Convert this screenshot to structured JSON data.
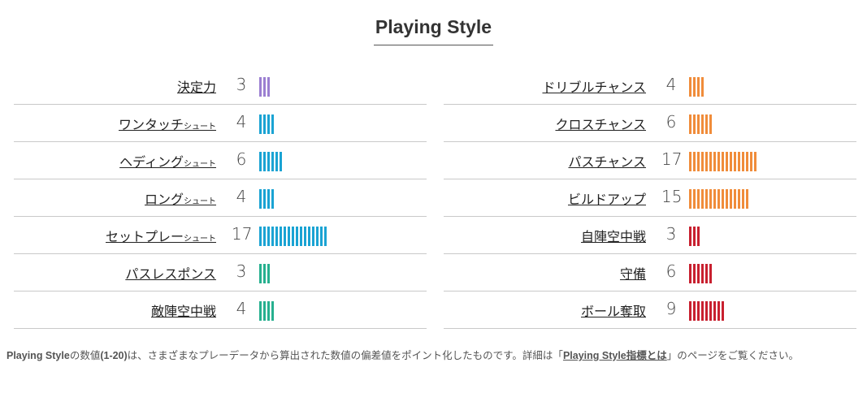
{
  "title": "Playing Style",
  "colors": {
    "purple": "#9b7fd1",
    "blue": "#1aa3d3",
    "teal": "#27b08f",
    "orange": "#f08c3a",
    "red": "#c8202f"
  },
  "left": [
    {
      "label": "決定力",
      "sub": "",
      "value": 3,
      "color": "#9b7fd1"
    },
    {
      "label": "ワンタッチ",
      "sub": "シュート",
      "value": 4,
      "color": "#1aa3d3"
    },
    {
      "label": "ヘディング",
      "sub": "シュート",
      "value": 6,
      "color": "#1aa3d3"
    },
    {
      "label": "ロング",
      "sub": "シュート",
      "value": 4,
      "color": "#1aa3d3"
    },
    {
      "label": "セットプレー",
      "sub": "シュート",
      "value": 17,
      "color": "#1aa3d3"
    },
    {
      "label": "パスレスポンス",
      "sub": "",
      "value": 3,
      "color": "#27b08f"
    },
    {
      "label": "敵陣空中戦",
      "sub": "",
      "value": 4,
      "color": "#27b08f"
    }
  ],
  "right": [
    {
      "label": "ドリブルチャンス",
      "sub": "",
      "value": 4,
      "color": "#f08c3a"
    },
    {
      "label": "クロスチャンス",
      "sub": "",
      "value": 6,
      "color": "#f08c3a"
    },
    {
      "label": "パスチャンス",
      "sub": "",
      "value": 17,
      "color": "#f08c3a"
    },
    {
      "label": "ビルドアップ",
      "sub": "",
      "value": 15,
      "color": "#f08c3a"
    },
    {
      "label": "自陣空中戦",
      "sub": "",
      "value": 3,
      "color": "#c8202f"
    },
    {
      "label": "守備",
      "sub": "",
      "value": 6,
      "color": "#c8202f"
    },
    {
      "label": "ボール奪取",
      "sub": "",
      "value": 9,
      "color": "#c8202f"
    }
  ],
  "note": {
    "prefix_bold": "Playing Style",
    "text1": "の数値",
    "range_bold": "(1-20)",
    "text2": "は、さまざまなプレーデータから算出された数値の偏差値をポイント化したものです。詳細は「",
    "link": "Playing Style指標とは",
    "text3": "」のページをご覧ください。"
  }
}
